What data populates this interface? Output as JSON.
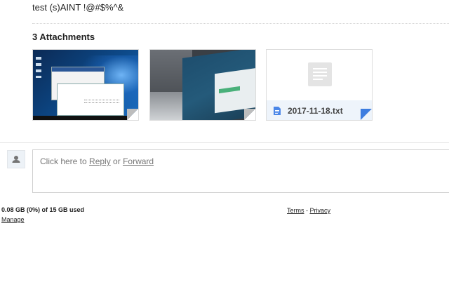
{
  "message": {
    "body_text": "test (s)AINT !@#$%^&"
  },
  "attachments": {
    "heading": "3 Attachments",
    "items": [
      {
        "kind": "image",
        "icon": "image-thumbnail"
      },
      {
        "kind": "image",
        "icon": "image-thumbnail"
      },
      {
        "kind": "text-file",
        "file_name": "2017-11-18.txt",
        "icon": "document-icon"
      }
    ]
  },
  "reply": {
    "prefix": "Click here to ",
    "reply_link": "Reply",
    "or_text": " or ",
    "forward_link": "Forward"
  },
  "footer": {
    "storage_text": "0.08 GB (0%) of 15 GB used",
    "manage_link": "Manage",
    "terms_link": "Terms",
    "separator": " - ",
    "privacy_link": "Privacy"
  },
  "colors": {
    "accent_blue": "#3d7de0",
    "label_bar": "#eef4fb"
  }
}
